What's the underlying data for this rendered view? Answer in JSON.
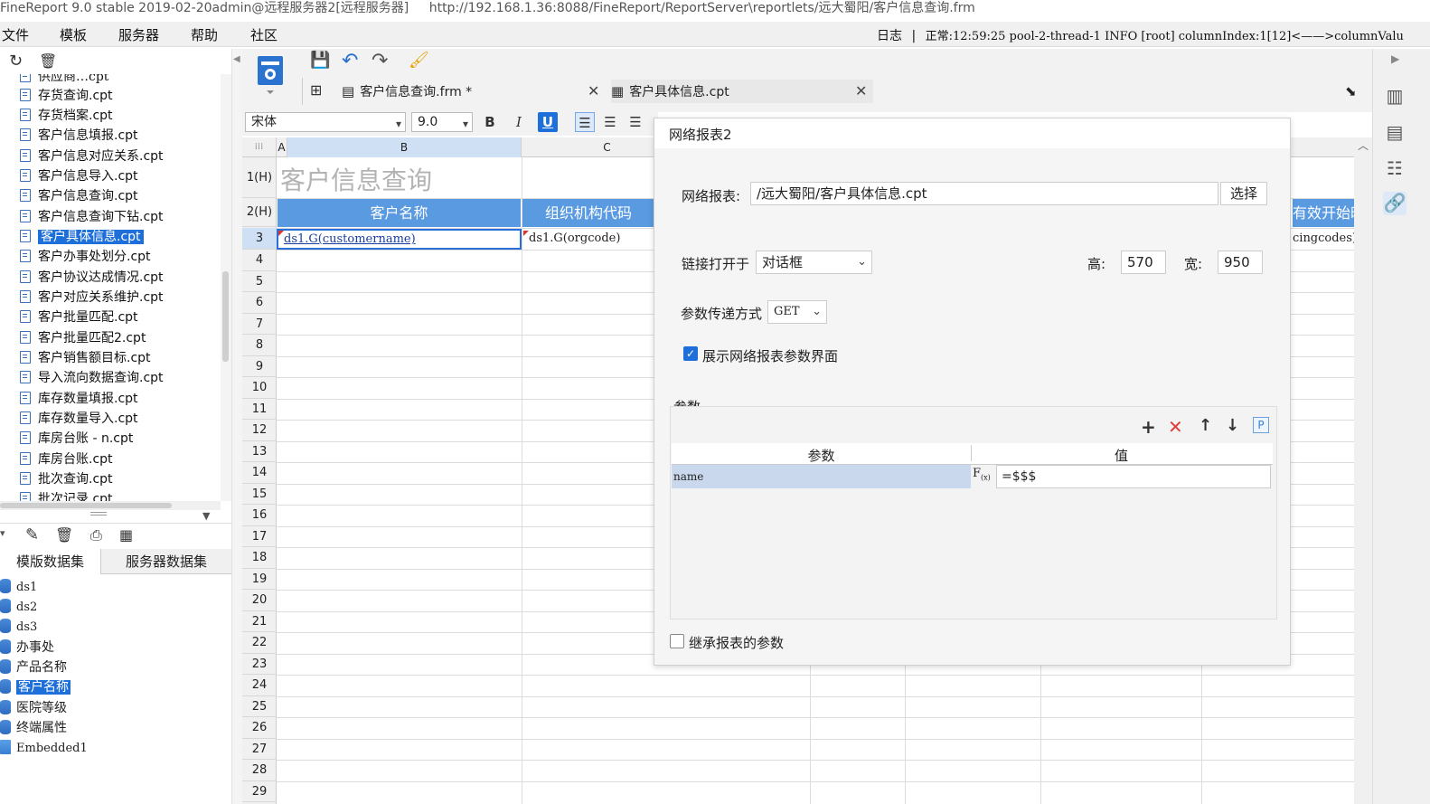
{
  "window": {
    "title": "FineReport 9.0 stable 2019-02-20admin@远程服务器2[远程服务器]",
    "url": "http://192.168.1.36:8088/FineReport/ReportServer\\reportlets/远大蜀阳/客户信息查询.frm"
  },
  "menu": {
    "items": [
      "文件",
      "模板",
      "服务器",
      "帮助",
      "社区"
    ],
    "log_label": "日志",
    "status": "正常:12:59:25 pool-2-thread-1 INFO [root] columnIndex:1[12]<——>columnValu"
  },
  "tree": {
    "items": [
      {
        "label": "供应商…cpt",
        "partial": true
      },
      {
        "label": "存货查询.cpt"
      },
      {
        "label": "存货档案.cpt"
      },
      {
        "label": "客户信息填报.cpt"
      },
      {
        "label": "客户信息对应关系.cpt"
      },
      {
        "label": "客户信息导入.cpt"
      },
      {
        "label": "客户信息查询.cpt"
      },
      {
        "label": "客户信息查询下钻.cpt"
      },
      {
        "label": "客户具体信息.cpt",
        "selected": true
      },
      {
        "label": "客户办事处划分.cpt"
      },
      {
        "label": "客户协议达成情况.cpt"
      },
      {
        "label": "客户对应关系维护.cpt"
      },
      {
        "label": "客户批量匹配.cpt"
      },
      {
        "label": "客户批量匹配2.cpt"
      },
      {
        "label": "客户销售额目标.cpt"
      },
      {
        "label": "导入流向数据查询.cpt"
      },
      {
        "label": "库存数量填报.cpt"
      },
      {
        "label": "库存数量导入.cpt"
      },
      {
        "label": "库房台账 - n.cpt"
      },
      {
        "label": "库房台账.cpt"
      },
      {
        "label": "批次查询.cpt"
      },
      {
        "label": "批次记录.cpt"
      }
    ]
  },
  "datasets": {
    "tabs": [
      "模版数据集",
      "服务器数据集"
    ],
    "items": [
      {
        "label": "ds1",
        "mono": true
      },
      {
        "label": "ds2",
        "mono": true
      },
      {
        "label": "ds3",
        "mono": true
      },
      {
        "label": "办事处"
      },
      {
        "label": "产品名称"
      },
      {
        "label": "客户名称",
        "selected": true
      },
      {
        "label": "医院等级"
      },
      {
        "label": "终端属性"
      },
      {
        "label": "Embedded1",
        "mono": true
      }
    ]
  },
  "tabs": [
    {
      "label": "客户信息查询.frm *",
      "active": true
    },
    {
      "label": "客户具体信息.cpt",
      "active": false
    }
  ],
  "format": {
    "font": "宋体",
    "size": "9.0",
    "bold": "B",
    "italic": "I",
    "underline": "U"
  },
  "sheet": {
    "columns": [
      "A",
      "B",
      "C"
    ],
    "rows": [
      "1(H)",
      "2(H)",
      "3",
      "4",
      "5",
      "6",
      "7",
      "8",
      "9",
      "10",
      "11",
      "12",
      "13",
      "14",
      "15",
      "16",
      "17",
      "18",
      "19",
      "20",
      "21",
      "22",
      "23",
      "24",
      "25",
      "26",
      "27",
      "28",
      "29"
    ],
    "title": "客户信息查询",
    "headers": [
      "客户名称",
      "组织机构代码",
      "有效开始时"
    ],
    "b3": "ds1.G(customername)",
    "c3": "ds1.G(orgcode)",
    "far3": "cingcodes)"
  },
  "dialog": {
    "title": "网络报表2",
    "report_label": "网络报表:",
    "report_value": "/远大蜀阳/客户具体信息.cpt",
    "choose_label": "选择",
    "open_in_label": "链接打开于",
    "open_in_value": "对话框",
    "height_label": "高:",
    "height_value": "570",
    "width_label": "宽:",
    "width_value": "950",
    "method_label": "参数传递方式",
    "method_value": "GET",
    "show_params_label": "展示网络报表参数界面",
    "show_params_checked": true,
    "params_section": "参数",
    "param_col_name": "参数",
    "param_col_value": "值",
    "param_rows": [
      {
        "name": "name",
        "value": "=$$$"
      }
    ],
    "inherit_label": "继承报表的参数",
    "inherit_checked": false
  },
  "colors": {
    "accent": "#1e6fd9",
    "header_blue": "#5a9ae0",
    "delete_red": "#e23b3b"
  }
}
